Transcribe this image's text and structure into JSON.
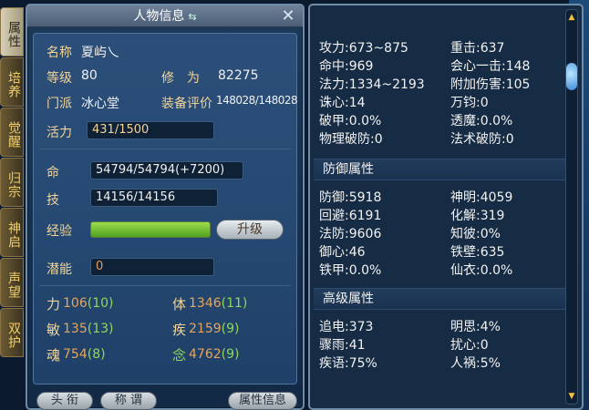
{
  "tabs": [
    "属性",
    "培养",
    "觉醒",
    "归宗",
    "神启",
    "声望",
    "双护"
  ],
  "window": {
    "title": "人物信息"
  },
  "profile": {
    "name_label": "名称",
    "name": "夏屿乀",
    "level_label": "等级",
    "level": "80",
    "cultivation_label": "修　为",
    "cultivation": "82275",
    "sect_label": "门派",
    "sect": "冰心堂",
    "gear_label": "装备评价",
    "gear": "148028/148028"
  },
  "vitals": {
    "mp_label": "活力",
    "mp": "431/1500",
    "hp_label": "命",
    "hp": "54794/54794(+7200)",
    "skill_label": "技",
    "skill": "14156/14156",
    "exp_label": "经验",
    "exp_fill_percent": 100,
    "upgrade_button": "升级",
    "potential_label": "潜能",
    "potential": "0"
  },
  "attributes": [
    {
      "label": "力",
      "base": "106",
      "bonus": "(10)"
    },
    {
      "label": "体",
      "base": "1346",
      "bonus": "(11)"
    },
    {
      "label": "敏",
      "base": "135",
      "bonus": "(13)"
    },
    {
      "label": "疾",
      "base": "2159",
      "bonus": "(9)"
    },
    {
      "label": "魂",
      "base": "754",
      "bonus": "(8)"
    },
    {
      "label": "念",
      "base": "4762",
      "bonus": "(9)"
    }
  ],
  "bottom_buttons": {
    "title_btn": "头 衔",
    "nickname_btn": "称 谓",
    "attr_info_btn": "属性信息"
  },
  "stats_attack": [
    {
      "l": "攻力:673~875",
      "r": "重击:637"
    },
    {
      "l": "命中:969",
      "r": "会心一击:148"
    },
    {
      "l": "法力:1334~2193",
      "r": "附加伤害:105"
    },
    {
      "l": "诛心:14",
      "r": "万钧:0"
    },
    {
      "l": "破甲:0.0%",
      "r": "透魔:0.0%"
    },
    {
      "l": "物理破防:0",
      "r": "法术破防:0"
    }
  ],
  "defense_title": "防御属性",
  "stats_defense": [
    {
      "l": "防御:5918",
      "r": "神明:4059"
    },
    {
      "l": "回避:6191",
      "r": "化解:319"
    },
    {
      "l": "法防:9606",
      "r": "知彼:0%"
    },
    {
      "l": "御心:46",
      "r": "铁壁:635"
    },
    {
      "l": "铁甲:0.0%",
      "r": "仙衣:0.0%"
    }
  ],
  "advanced_title": "高级属性",
  "stats_advanced": [
    {
      "l": "追电:373",
      "r": "明思:4%"
    },
    {
      "l": "骤雨:41",
      "r": "扰心:0"
    },
    {
      "l": "疾语:75%",
      "r": "人祸:5%"
    }
  ],
  "colors": {
    "label_gold": "#f2d49a",
    "attr_base": "#e6a55a",
    "attr_bonus": "#8ed85a",
    "exp_green": "#6cc02e",
    "accent_yellow": "#f0c040"
  }
}
